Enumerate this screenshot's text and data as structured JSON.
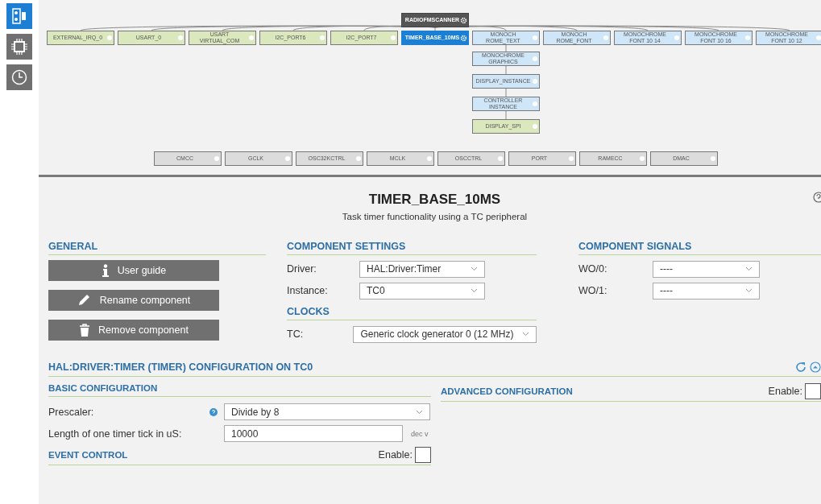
{
  "sidebar": [
    {
      "selected": true
    },
    {
      "selected": false
    },
    {
      "selected": false
    }
  ],
  "diagram": {
    "root": {
      "label": "RADIOFMSCANNER"
    },
    "top_row": [
      {
        "label": "EXTERNAL_IRQ_0",
        "kind": "green"
      },
      {
        "label": "USART_0",
        "kind": "green"
      },
      {
        "label": "USART VIRTUAL_COM",
        "kind": "green"
      },
      {
        "label": "I2C_PORT6",
        "kind": "green"
      },
      {
        "label": "I2C_PORT7",
        "kind": "green"
      },
      {
        "label": "TIMER_BASE_10MS",
        "kind": "selected"
      },
      {
        "label": "MONOCH ROME_TEXT",
        "kind": "blue"
      },
      {
        "label": "MONOCH ROME_FONT",
        "kind": "blue"
      },
      {
        "label": "MONOCHROME FONT 10 14",
        "kind": "blue"
      },
      {
        "label": "MONOCHROME FONT 10 16",
        "kind": "blue"
      },
      {
        "label": "MONOCHROME FONT 10 12",
        "kind": "blue"
      }
    ],
    "chain": [
      {
        "label": "MONOCHROME GRAPHICS",
        "kind": "blue"
      },
      {
        "label": "DISPLAY_INSTANCE",
        "kind": "blue"
      },
      {
        "label": "CONTROLLER INSTANCE",
        "kind": "blue"
      },
      {
        "label": "DISPLAY_SPI",
        "kind": "green"
      }
    ],
    "bottom_row": [
      {
        "label": "CMCC",
        "kind": "gray"
      },
      {
        "label": "GCLK",
        "kind": "gray"
      },
      {
        "label": "OSC32KCTRL",
        "kind": "gray"
      },
      {
        "label": "MCLK",
        "kind": "gray"
      },
      {
        "label": "OSCCTRL",
        "kind": "gray"
      },
      {
        "label": "PORT",
        "kind": "gray"
      },
      {
        "label": "RAMECC",
        "kind": "gray"
      },
      {
        "label": "DMAC",
        "kind": "gray"
      }
    ]
  },
  "component": {
    "title": "TIMER_BASE_10MS",
    "subtitle": "Task timer functionality using a TC peripheral"
  },
  "general": {
    "heading": "GENERAL",
    "buttons": [
      {
        "label": "User guide"
      },
      {
        "label": "Rename component"
      },
      {
        "label": "Remove component"
      }
    ]
  },
  "settings": {
    "heading": "COMPONENT SETTINGS",
    "fields": [
      {
        "label": "Driver:",
        "value": "HAL:Driver:Timer"
      },
      {
        "label": "Instance:",
        "value": "TC0"
      }
    ]
  },
  "clocks": {
    "heading": "CLOCKS",
    "fields": [
      {
        "label": "TC:",
        "value": "Generic clock generator 0 (12 MHz)"
      }
    ]
  },
  "signals": {
    "heading": "COMPONENT SIGNALS",
    "fields": [
      {
        "label": "WO/0:",
        "value": "----"
      },
      {
        "label": "WO/1:",
        "value": "----"
      }
    ]
  },
  "configuration": {
    "heading": "HAL:DRIVER:TIMER (TIMER) CONFIGURATION ON TC0",
    "basic": {
      "heading": "BASIC CONFIGURATION",
      "rows": [
        {
          "kind": "select",
          "label": "Prescaler:",
          "value": "Divide by 8",
          "help": true
        },
        {
          "kind": "input",
          "label": "Length of one timer tick in uS:",
          "value": "10000",
          "unit": "dec v",
          "help": false
        }
      ]
    },
    "advanced": {
      "heading": "ADVANCED CONFIGURATION",
      "enable_label": "Enable:",
      "enabled": false
    },
    "event": {
      "heading": "EVENT CONTROL",
      "enable_label": "Enable:",
      "enabled": false
    }
  }
}
